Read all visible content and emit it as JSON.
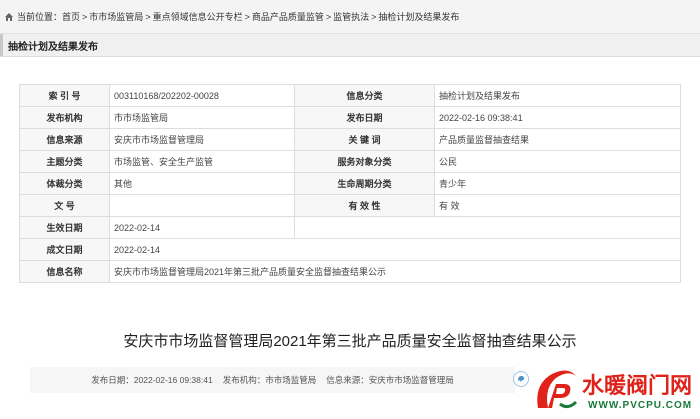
{
  "breadcrumb": {
    "prefix": "当前位置：",
    "items": [
      "首页",
      "市市场监管局",
      "重点领域信息公开专栏",
      "商品产品质量监管",
      "监管执法",
      "抽检计划及结果发布"
    ],
    "separator": ">"
  },
  "section": {
    "title": "抽检计划及结果发布"
  },
  "info_table": {
    "rows": [
      {
        "l1": "索 引 号",
        "v1": "003110168/202202-00028",
        "l2": "信息分类",
        "v2": "抽检计划及结果发布"
      },
      {
        "l1": "发布机构",
        "v1": "市市场监管局",
        "l2": "发布日期",
        "v2": "2022-02-16 09:38:41"
      },
      {
        "l1": "信息来源",
        "v1": "安庆市市场监督管理局",
        "l2": "关 键 词",
        "v2": "产品质量监督抽查结果"
      },
      {
        "l1": "主题分类",
        "v1": "市场监管、安全生产监管",
        "l2": "服务对象分类",
        "v2": "公民"
      },
      {
        "l1": "体裁分类",
        "v1": "其他",
        "l2": "生命周期分类",
        "v2": "青少年"
      },
      {
        "l1": "文 号",
        "v1": "",
        "l2": "有 效 性",
        "v2": "有 效"
      },
      {
        "l1": "生效日期",
        "v1": "2022-02-14"
      },
      {
        "l1": "成文日期",
        "v1": "2022-02-14"
      },
      {
        "l1": "信息名称",
        "v1": "安庆市市场监督管理局2021年第三批产品质量安全监督抽查结果公示"
      }
    ]
  },
  "document": {
    "title": "安庆市市场监督管理局2021年第三批产品质量安全监督抽查结果公示"
  },
  "footer_meta": {
    "publish_date": "发布日期：2022-02-16 09:38:41",
    "publisher": "发布机构：市市场监管局",
    "source": "信息来源：安庆市市场监督管理局"
  },
  "watermark": {
    "name": "水暖阀门网",
    "url": "WWW.PVCPU.COM"
  },
  "colors": {
    "watermark_red": "#e0231a",
    "watermark_green": "#1a7a3a",
    "label_bg": "#f7f7f7",
    "border": "#dddddd"
  },
  "icons": [
    "home-icon",
    "share-icon",
    "logo-mark"
  ]
}
